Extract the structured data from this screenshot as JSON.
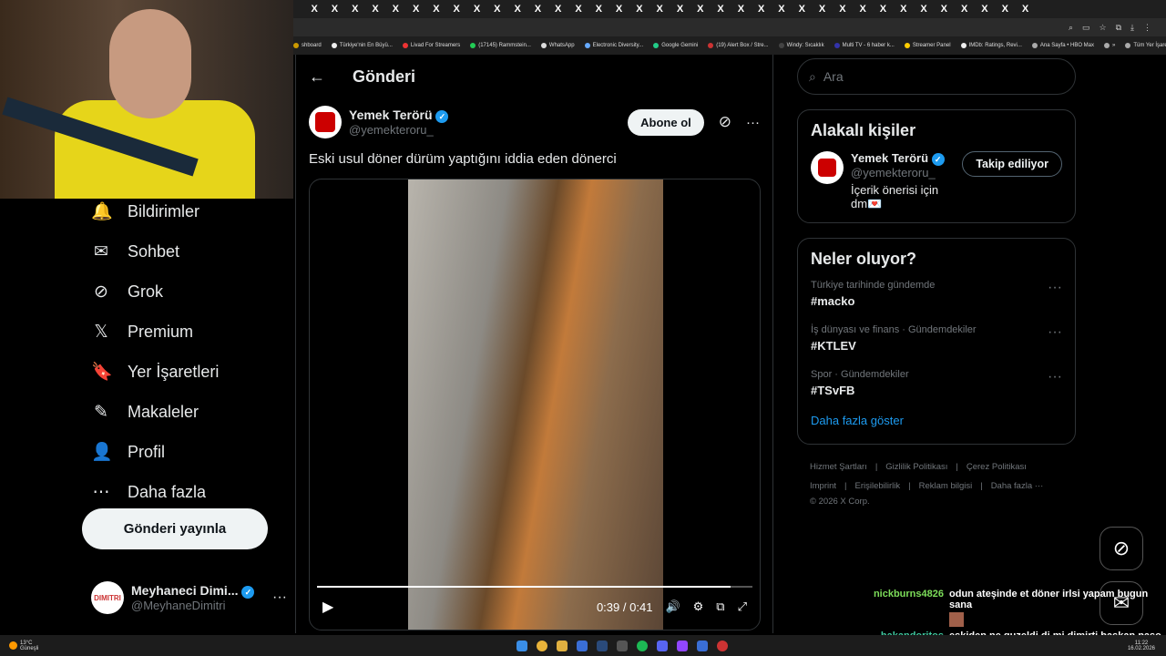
{
  "browser": {
    "tab_label": "X",
    "tab_count": 36,
    "bookmarks": [
      "shboard",
      "Türkiye'nin En Büyü...",
      "Livad For Streamers",
      "(17145) Rammstein...",
      "WhatsApp",
      "Electronic Diversity...",
      "Google Gemini",
      "(19) Alert Box / Stre...",
      "Windy: Sıcaklık",
      "Multi TV - 6 haber k...",
      "Streamer Panel",
      "IMDb: Ratings, Revi...",
      "Ana Sayfa • HBO Max",
      "»",
      "Tüm Yer İşaretleri"
    ]
  },
  "sidebar": {
    "items": [
      {
        "label": "Bildirimler",
        "icon": "bell-icon",
        "glyph": "🔔"
      },
      {
        "label": "Sohbet",
        "icon": "mail-icon",
        "glyph": "✉"
      },
      {
        "label": "Grok",
        "icon": "grok-icon",
        "glyph": "⊘"
      },
      {
        "label": "Premium",
        "icon": "x-logo-icon",
        "glyph": "𝕏"
      },
      {
        "label": "Yer İşaretleri",
        "icon": "bookmark-icon",
        "glyph": "🔖"
      },
      {
        "label": "Makaleler",
        "icon": "article-icon",
        "glyph": "✎"
      },
      {
        "label": "Profil",
        "icon": "person-icon",
        "glyph": "👤"
      },
      {
        "label": "Daha fazla",
        "icon": "more-circle-icon",
        "glyph": "⋯"
      }
    ],
    "post_button": "Gönderi yayınla",
    "account": {
      "name": "Meyhaneci Dimi...",
      "handle": "@MeyhaneDimitri",
      "avatar_text": "DIMITRI"
    }
  },
  "main": {
    "title": "Gönderi",
    "author": {
      "name": "Yemek Terörü",
      "handle": "@yemekteroru_"
    },
    "subscribe": "Abone ol",
    "text": "Eski usul döner dürüm yaptığını iddia eden dönerci",
    "video": {
      "current": "0:39",
      "duration": "0:41",
      "separator": "/",
      "progress": 0.95
    }
  },
  "right": {
    "search_placeholder": "Ara",
    "related": {
      "title": "Alakalı kişiler",
      "name": "Yemek Terörü",
      "handle": "@yemekteroru_",
      "bio": "İçerik önerisi için dm💌",
      "follow": "Takip ediliyor"
    },
    "trends": {
      "title": "Neler oluyor?",
      "items": [
        {
          "meta": "Türkiye tarihinde gündemde",
          "tag": "#macko"
        },
        {
          "meta": "İş dünyası ve finans · Gündemdekiler",
          "tag": "#KTLEV"
        },
        {
          "meta": "Spor · Gündemdekiler",
          "tag": "#TSvFB"
        }
      ],
      "show_more": "Daha fazla göster"
    },
    "footer": {
      "row1": [
        "Hizmet Şartları",
        "Gizlilik Politikası",
        "Çerez Politikası"
      ],
      "row2": [
        "Imprint",
        "Erişilebilirlik",
        "Reklam bilgisi",
        "Daha fazla ···"
      ],
      "copyright": "© 2026 X Corp."
    }
  },
  "chat": [
    {
      "user": "nickburns4826",
      "color": "#7dde5a",
      "message": "odun ateşinde et döner irlsi yapam bugun sana"
    },
    {
      "user": "hakandoritos",
      "color": "#3fc9a0",
      "message": "eskiden ne guzeldi di mi dimirti baskan paso et döner alırdık sokaktaki büfelerden xD"
    }
  ],
  "taskbar": {
    "weather_temp": "13°C",
    "weather_text": "Güneşli",
    "time": "11:22",
    "date": "16.02.2026"
  },
  "colors": {
    "accent": "#1d9bf0",
    "bg": "#000000",
    "border": "#2f3336"
  }
}
